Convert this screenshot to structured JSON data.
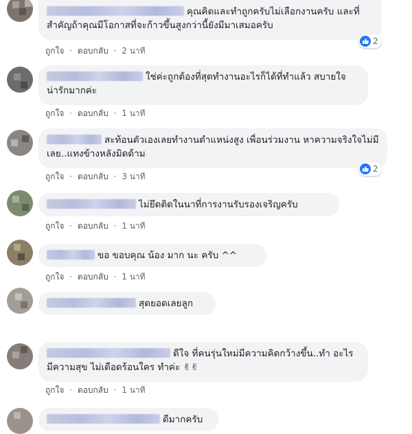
{
  "accent": "#2078f4",
  "actions": {
    "like": "ถูกใจ",
    "reply": "ตอบกลับ",
    "sep": "·"
  },
  "comments": [
    {
      "text": "คุณคิดและทำถูกครับไม่เลือกงานครับ และที่สำคัญถ้าคุณมีโอกาสที่จะก้าวขึ้นสูงกว่านี้ยังมีมาเสมอครับ",
      "time": "2 นาที",
      "likes": "2"
    },
    {
      "text": "ใช่ค่ะถูกต้องที่สุดทำงานอะไรก็ได้ที่ทำแล้ว สบายใจ น่ารักมากค่ะ",
      "time": "1 นาที"
    },
    {
      "text": "สะท้อนตัวเองเลยทำงานตำแหน่งสูง เพื่อนร่วมงาน หาความจริงใจไม่มีเลย..แทงข้างหลังมิดด้าม",
      "time": "3 นาที",
      "likes": "2"
    },
    {
      "text": "ไม่ยึดติดในนาที่การงานรับรองเจริญครับ",
      "time": "1 นาที"
    },
    {
      "text": "ขอ ขอบคุณ น้อง มาก นะ ครับ ^^",
      "time": "1 นาที"
    },
    {
      "text": "สุดยอดเลยลูก"
    },
    {
      "text": "ดีใจ ที่คนรุ่นใหม่มีความคิดกว้างขึ้น..ทำ อะไร มีความสุข ไม่เดือดร้อนใคร ทำค่ะ ✌✌",
      "time": "1 นาที"
    },
    {
      "text": "ดีมากครับ"
    }
  ]
}
